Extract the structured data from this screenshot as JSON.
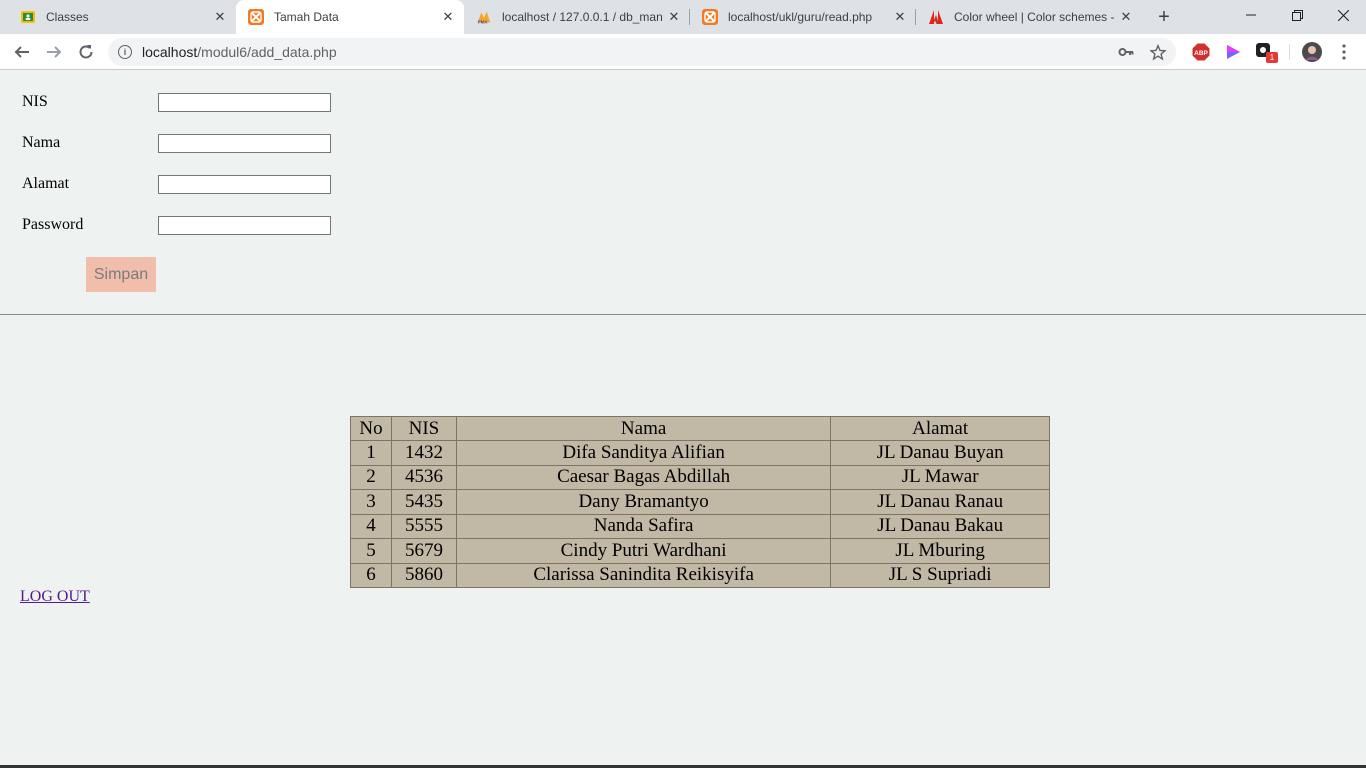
{
  "browser": {
    "tabs": [
      {
        "title": "Classes",
        "favicon": "google-classroom-icon",
        "active": false
      },
      {
        "title": "Tamah Data",
        "favicon": "xampp-icon",
        "active": true
      },
      {
        "title": "localhost / 127.0.0.1 / db_man",
        "favicon": "phpmyadmin-icon",
        "active": false
      },
      {
        "title": "localhost/ukl/guru/read.php",
        "favicon": "xampp-icon",
        "active": false
      },
      {
        "title": "Color wheel | Color schemes -",
        "favicon": "adobe-icon",
        "active": false
      }
    ],
    "address": {
      "host": "localhost",
      "path": "/modul6/add_data.php"
    },
    "extension_badge": "1"
  },
  "form": {
    "nis_label": "NIS",
    "nama_label": "Nama",
    "alamat_label": "Alamat",
    "password_label": "Password",
    "submit_label": "Simpan"
  },
  "table": {
    "headers": [
      "No",
      "NIS",
      "Nama",
      "Alamat"
    ],
    "rows": [
      [
        "1",
        "1432",
        "Difa Sanditya Alifian",
        "JL Danau Buyan"
      ],
      [
        "2",
        "4536",
        "Caesar Bagas Abdillah",
        "JL Mawar"
      ],
      [
        "3",
        "5435",
        "Dany Bramantyo",
        "JL Danau Ranau"
      ],
      [
        "4",
        "5555",
        "Nanda Safira",
        "JL Danau Bakau"
      ],
      [
        "5",
        "5679",
        "Cindy Putri Wardhani",
        "JL Mburing"
      ],
      [
        "6",
        "5860",
        "Clarissa Sanindita Reikisyifa",
        "JL S Supriadi"
      ]
    ]
  },
  "logout_label": "LOG OUT",
  "colors": {
    "table_bg": "#c1b8a5",
    "button_bg": "#f0beaa",
    "page_bg": "#eef2f1"
  }
}
